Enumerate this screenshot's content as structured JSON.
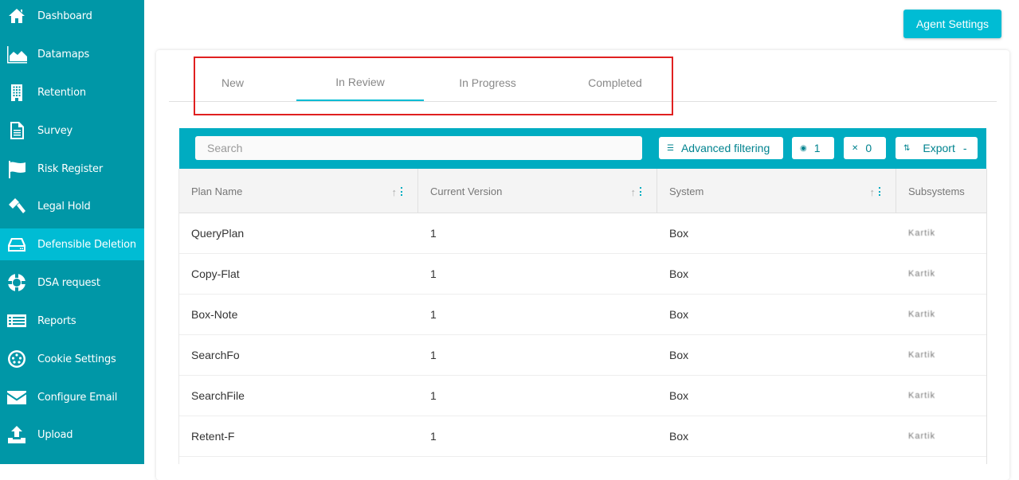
{
  "sidebar": {
    "items": [
      {
        "label": "Dashboard",
        "icon": "home-icon",
        "active": false
      },
      {
        "label": "Datamaps",
        "icon": "area-chart-icon",
        "active": false
      },
      {
        "label": "Retention",
        "icon": "building-icon",
        "active": false
      },
      {
        "label": "Survey",
        "icon": "document-icon",
        "active": false
      },
      {
        "label": "Risk Register",
        "icon": "flag-icon",
        "active": false
      },
      {
        "label": "Legal Hold",
        "icon": "gavel-icon",
        "active": false
      },
      {
        "label": "Defensible Deletion",
        "icon": "hard-drive-icon",
        "active": true
      },
      {
        "label": "DSA request",
        "icon": "lifebuoy-icon",
        "active": false
      },
      {
        "label": "Reports",
        "icon": "list-icon",
        "active": false
      },
      {
        "label": "Cookie Settings",
        "icon": "cookie-icon",
        "active": false
      },
      {
        "label": "Configure Email",
        "icon": "envelope-icon",
        "active": false
      },
      {
        "label": "Upload",
        "icon": "upload-icon",
        "active": false
      }
    ]
  },
  "header": {
    "agent_settings_label": "Agent Settings"
  },
  "tabs": [
    {
      "label": "New",
      "active": false
    },
    {
      "label": "In Review",
      "active": true
    },
    {
      "label": "In Progress",
      "active": false
    },
    {
      "label": "Completed",
      "active": false
    }
  ],
  "toolbar": {
    "search_placeholder": "Search",
    "search_value": "",
    "advanced_filtering_label": "Advanced filtering",
    "hidden_count": "1",
    "cleared_count": "0",
    "export_label": "Export",
    "export_caret": "-"
  },
  "table": {
    "columns": [
      "Plan Name",
      "Current Version",
      "System",
      "Subsystems"
    ],
    "rows": [
      {
        "plan_name": "QueryPlan",
        "current_version": "1",
        "system": "Box",
        "subsystems": "Kartik"
      },
      {
        "plan_name": "Copy-Flat",
        "current_version": "1",
        "system": "Box",
        "subsystems": "Kartik"
      },
      {
        "plan_name": "Box-Note",
        "current_version": "1",
        "system": "Box",
        "subsystems": "Kartik"
      },
      {
        "plan_name": "SearchFo",
        "current_version": "1",
        "system": "Box",
        "subsystems": "Kartik"
      },
      {
        "plan_name": "SearchFile",
        "current_version": "1",
        "system": "Box",
        "subsystems": "Kartik"
      },
      {
        "plan_name": "Retent-F",
        "current_version": "1",
        "system": "Box",
        "subsystems": "Kartik"
      }
    ]
  },
  "colors": {
    "sidebar": "#0097a7",
    "sidebar_active": "#00bcd4",
    "accent": "#00bcd4",
    "toolbar": "#00acc1",
    "highlight": "#e02020"
  }
}
